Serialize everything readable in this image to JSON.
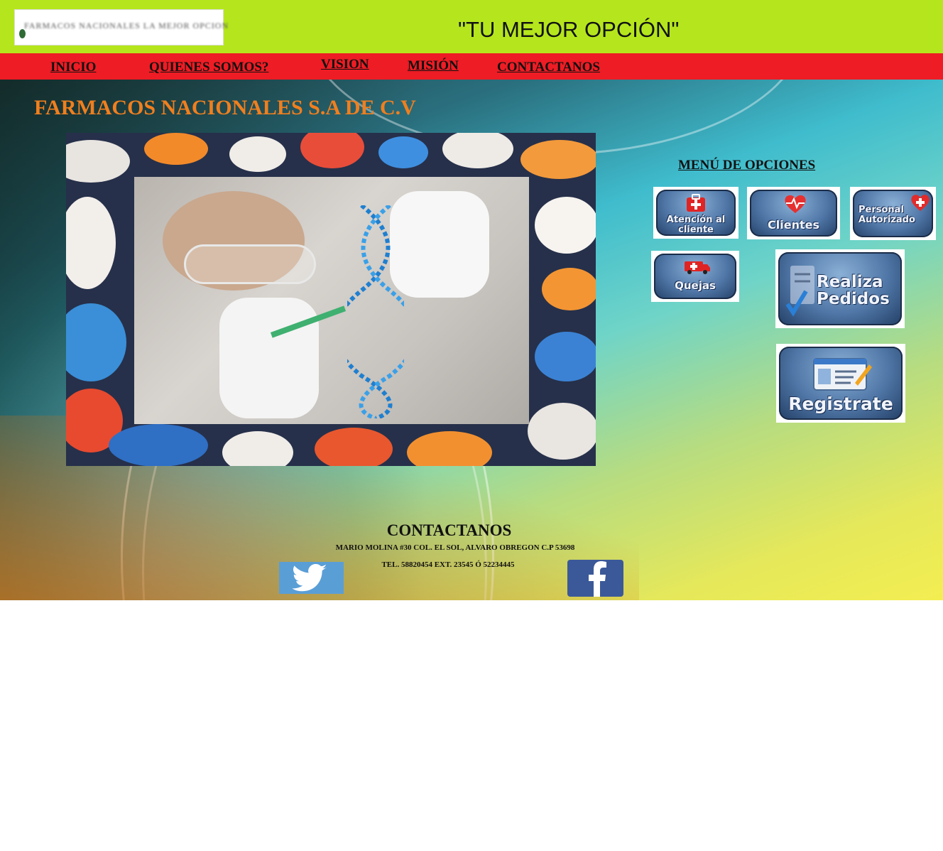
{
  "header": {
    "logo_text": "FARMACOS NACIONALES LA MEJOR OPCION",
    "slogan": "\"TU MEJOR OPCIÓN\""
  },
  "nav": {
    "items": [
      {
        "label": "INICIO"
      },
      {
        "label": "QUIENES SOMOS?"
      },
      {
        "label": "VISION"
      },
      {
        "label": "MISIÓN"
      },
      {
        "label": "CONTACTANOS"
      }
    ]
  },
  "main": {
    "company_title": "FARMACOS NACIONALES S.A DE C.V"
  },
  "menu": {
    "title": "MENÚ DE OPCIONES",
    "buttons": [
      {
        "label": "Atención al cliente",
        "icon": "first-aid-kit-icon"
      },
      {
        "label": "Clientes",
        "icon": "heart-monitor-icon"
      },
      {
        "label": "Personal Autorizado",
        "icon": "medical-heart-icon"
      },
      {
        "label": "Quejas",
        "icon": "ambulance-icon"
      },
      {
        "label": "Realiza Pedidos",
        "icon": "checklist-icon"
      },
      {
        "label": "Registrate",
        "icon": "id-card-icon"
      }
    ]
  },
  "footer": {
    "title": "CONTACTANOS",
    "address": "MARIO MOLINA #30 COL. EL SOL, ALVARO OBREGON C.P 53698",
    "phone": "TEL. 58820454 EXT. 23545 Ó 52234445",
    "social": [
      {
        "name": "twitter",
        "icon": "twitter-icon"
      },
      {
        "name": "facebook",
        "icon": "facebook-icon"
      }
    ]
  },
  "colors": {
    "topbar": "#b5e61d",
    "navbar": "#ee1c24",
    "title_orange": "#f07f1e",
    "twitter_blue": "#5a9ed6",
    "facebook_blue": "#3b5998"
  }
}
